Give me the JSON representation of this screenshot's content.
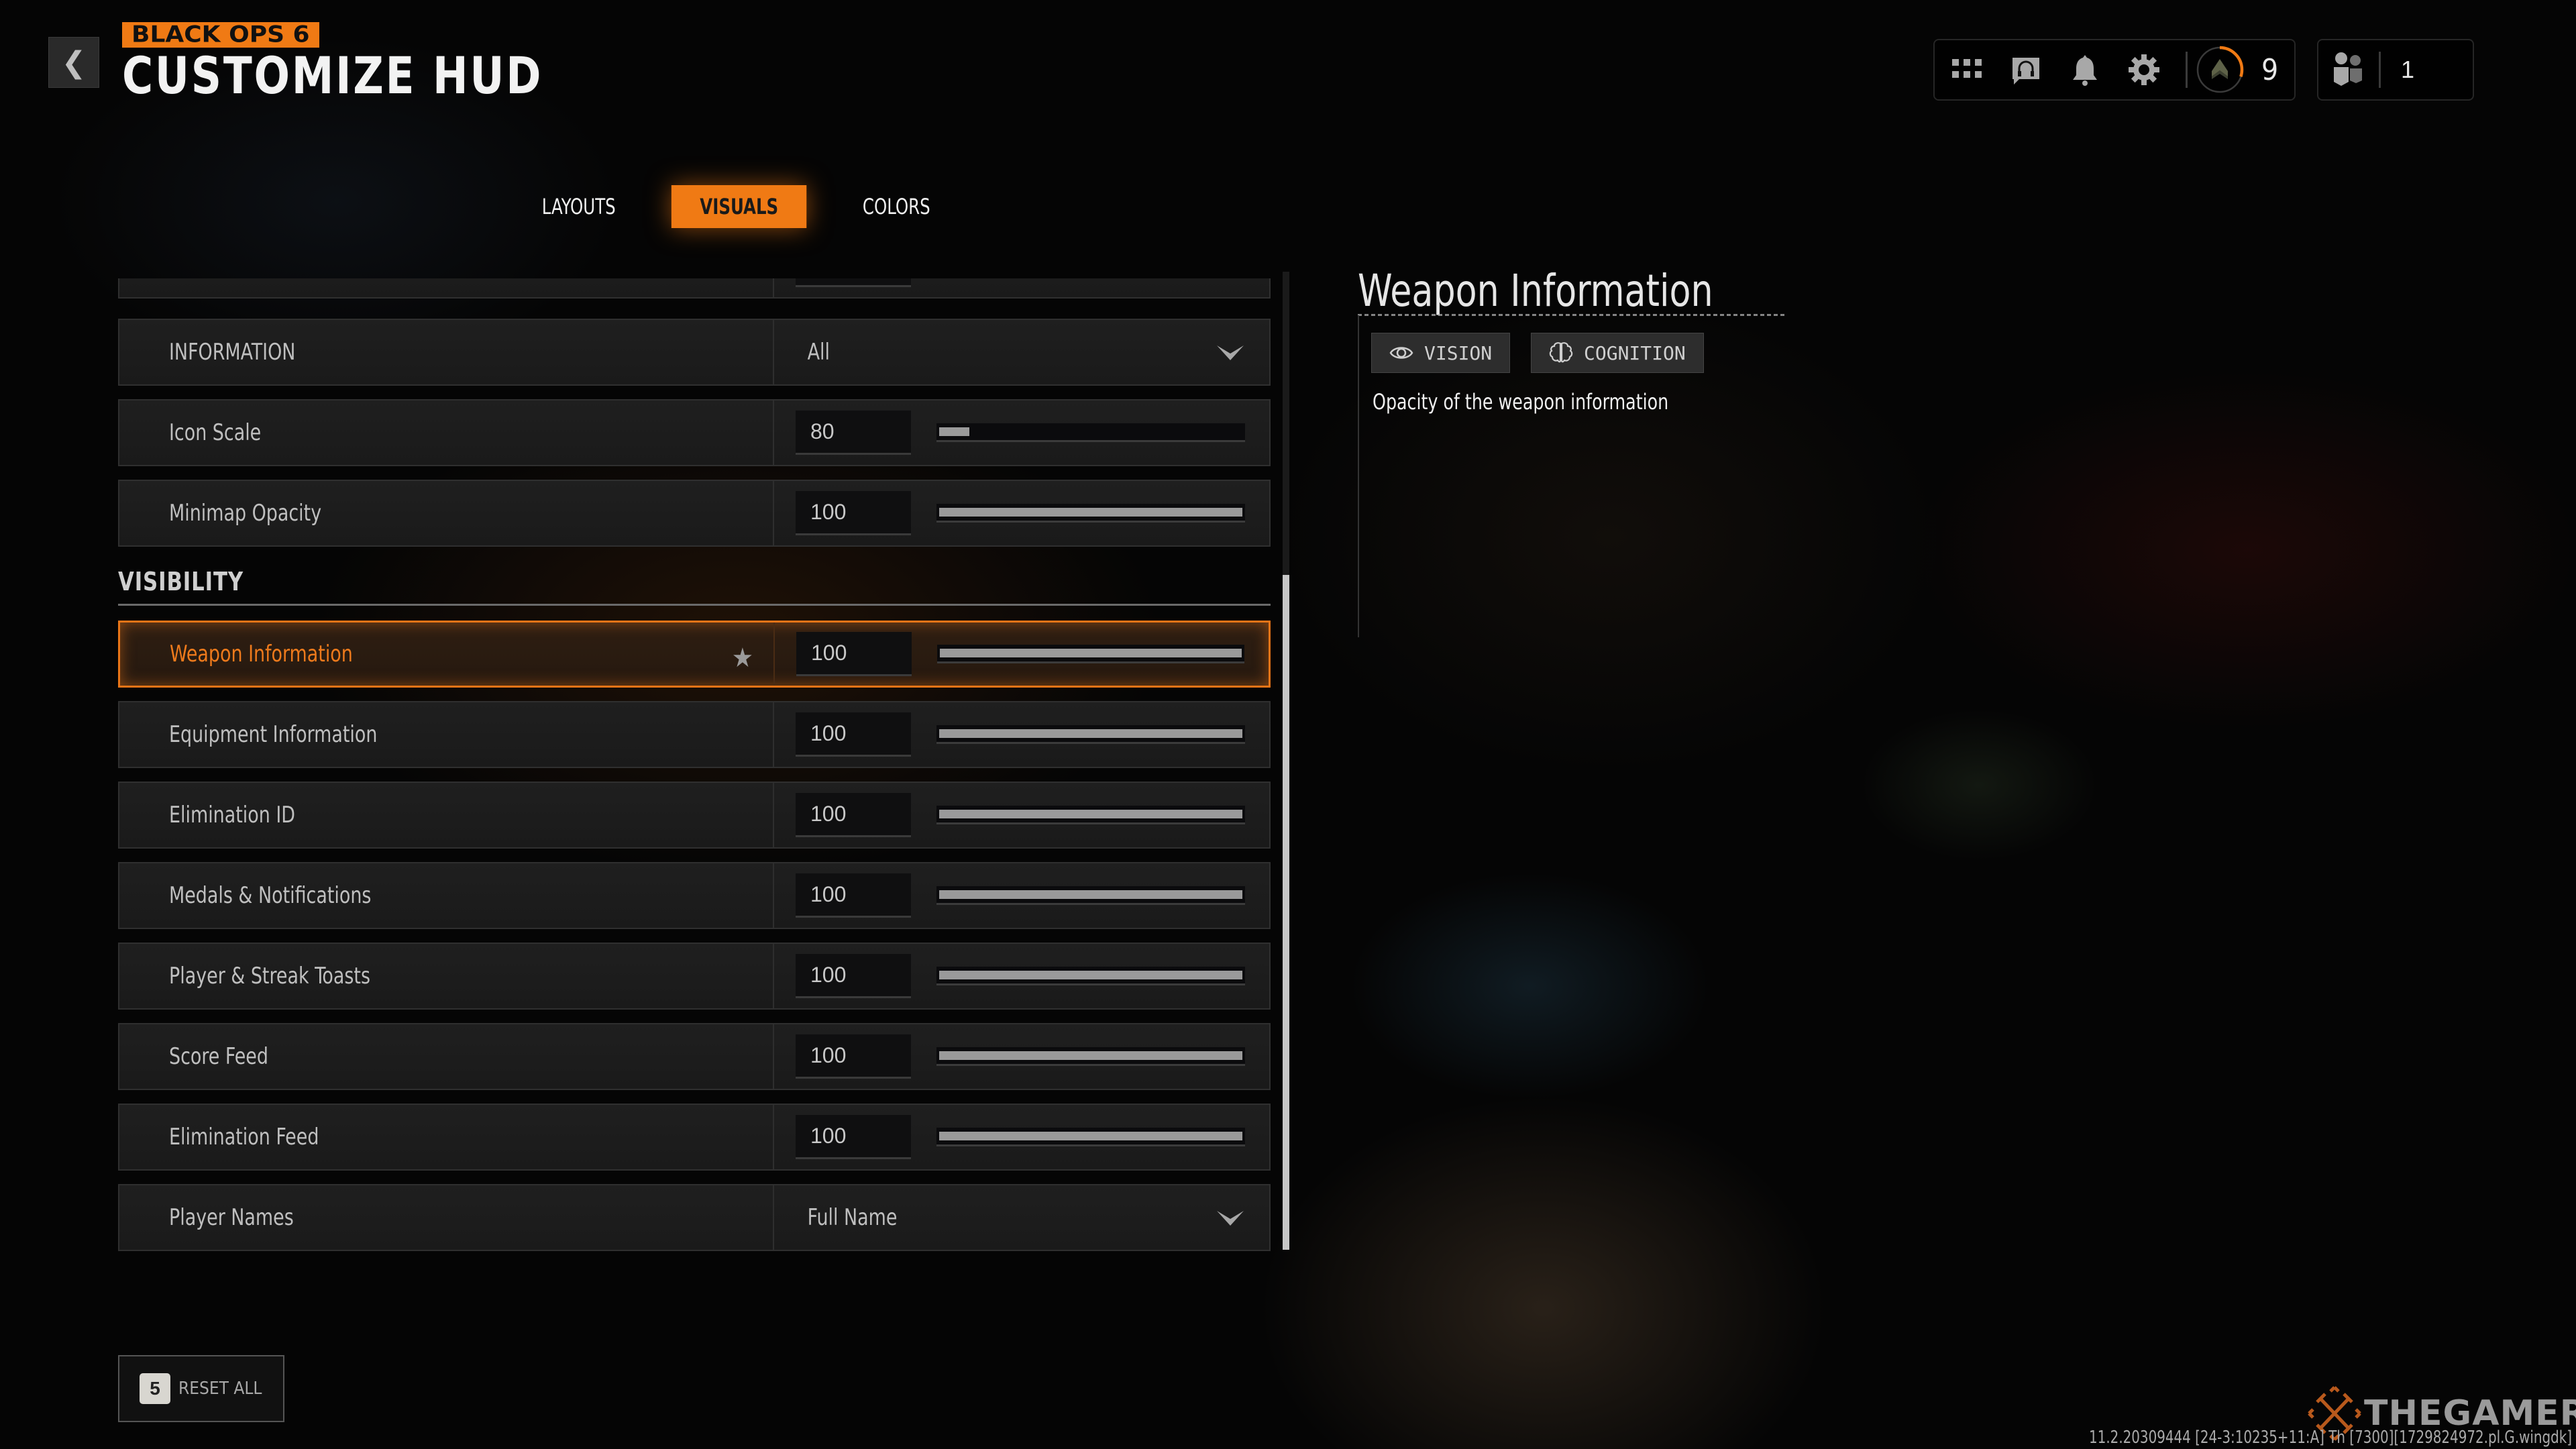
{
  "header": {
    "back_icon": "chevron-left-icon",
    "brand": "BLACK OPS 6",
    "title": "CUSTOMIZE HUD"
  },
  "status_bar": {
    "icons": [
      "grid-menu-icon",
      "headset-chat-icon",
      "bell-icon",
      "gear-icon"
    ],
    "rank_icon": "chevron-rank-icon",
    "rank_progress": 0.3,
    "level": "9",
    "party_icon": "party-members-icon",
    "party_count": "1"
  },
  "tabs": [
    {
      "label": "LAYOUTS",
      "active": false
    },
    {
      "label": "VISUALS",
      "active": true
    },
    {
      "label": "COLORS",
      "active": false
    }
  ],
  "settings": {
    "top_rows": [
      {
        "label": "INFORMATION",
        "type": "dropdown",
        "value": "All"
      },
      {
        "label": "Icon Scale",
        "type": "slider",
        "value": "80",
        "fill": 0.1
      },
      {
        "label": "Minimap Opacity",
        "type": "slider",
        "value": "100",
        "fill": 1.0
      }
    ],
    "section_title": "VISIBILITY",
    "visibility_rows": [
      {
        "label": "Weapon Information",
        "type": "slider",
        "value": "100",
        "fill": 1.0,
        "selected": true,
        "favorite": true
      },
      {
        "label": "Equipment Information",
        "type": "slider",
        "value": "100",
        "fill": 1.0
      },
      {
        "label": "Elimination ID",
        "type": "slider",
        "value": "100",
        "fill": 1.0
      },
      {
        "label": "Medals & Notifications",
        "type": "slider",
        "value": "100",
        "fill": 1.0
      },
      {
        "label": "Player & Streak Toasts",
        "type": "slider",
        "value": "100",
        "fill": 1.0
      },
      {
        "label": "Score Feed",
        "type": "slider",
        "value": "100",
        "fill": 1.0
      },
      {
        "label": "Elimination Feed",
        "type": "slider",
        "value": "100",
        "fill": 1.0
      },
      {
        "label": "Player Names",
        "type": "dropdown",
        "value": "Full Name"
      }
    ],
    "scroll_position": 0.31,
    "scroll_visible_fraction": 0.69
  },
  "info_panel": {
    "title": "Weapon Information",
    "tags": [
      {
        "label": "VISION",
        "icon": "eye-icon"
      },
      {
        "label": "COGNITION",
        "icon": "brain-icon"
      }
    ],
    "description": "Opacity of the weapon information"
  },
  "footer": {
    "reset_key": "5",
    "reset_label": "RESET ALL",
    "watermark": "THEGAMER",
    "build": "11.2.20309444 [24-3:10235+11:A] Th [7300][1729824972.pl.G.wingdk]"
  },
  "colors": {
    "accent": "#f07a14",
    "selected_border": "#e87417"
  }
}
